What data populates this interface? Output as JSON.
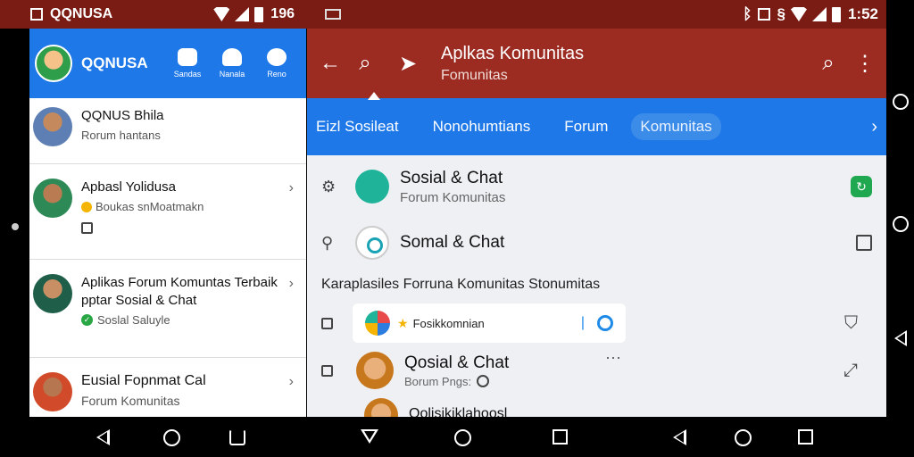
{
  "status_left": {
    "app": "QQNUSA",
    "time": "196"
  },
  "status_right": {
    "time": "1:52"
  },
  "left_panel": {
    "header": {
      "title": "QQNUSA",
      "buttons": [
        "Sandas",
        "Nanala",
        "Reno"
      ]
    },
    "items": [
      {
        "title": "QQNUS Bhila",
        "subtitle": "Rorum hantans"
      },
      {
        "title": "Apbasl Yolidusa",
        "subtitle": "Boukas snMoatmakn"
      },
      {
        "title": "Aplikas Forum Komuntas Terbaik pptar Sosial & Chat",
        "subtitle": "Soslal Saluyle"
      },
      {
        "title": "Eusial Fopnmat Cal",
        "subtitle": "Forum Komunitas"
      }
    ]
  },
  "right_panel": {
    "topbar": {
      "title": "Aplkas Komunitas",
      "subtitle": "Fomunitas"
    },
    "tabs": [
      "Eizl Sosileat",
      "Nonohumtians",
      "Forum",
      "Komunitas"
    ],
    "active_tab": "Komunitas",
    "rows": [
      {
        "title": "Sosial & Chat",
        "subtitle": "Forum Komunitas"
      },
      {
        "title": "Somal & Chat",
        "subtitle": ""
      }
    ],
    "heading": "Karaplasiles Forruna Komunitas Stonumitas",
    "card": {
      "text": "Fosikkomnian"
    },
    "row3": {
      "title": "Qosial & Chat",
      "subtitle": "Borum Pngs:"
    },
    "row4": {
      "title": "Qolisikiklahoosl"
    }
  },
  "colors": {
    "status_bar": "#7a1c14",
    "left_header": "#1e78e8",
    "right_topbar": "#9c2b22",
    "tabs_bar": "#1e78e8"
  }
}
